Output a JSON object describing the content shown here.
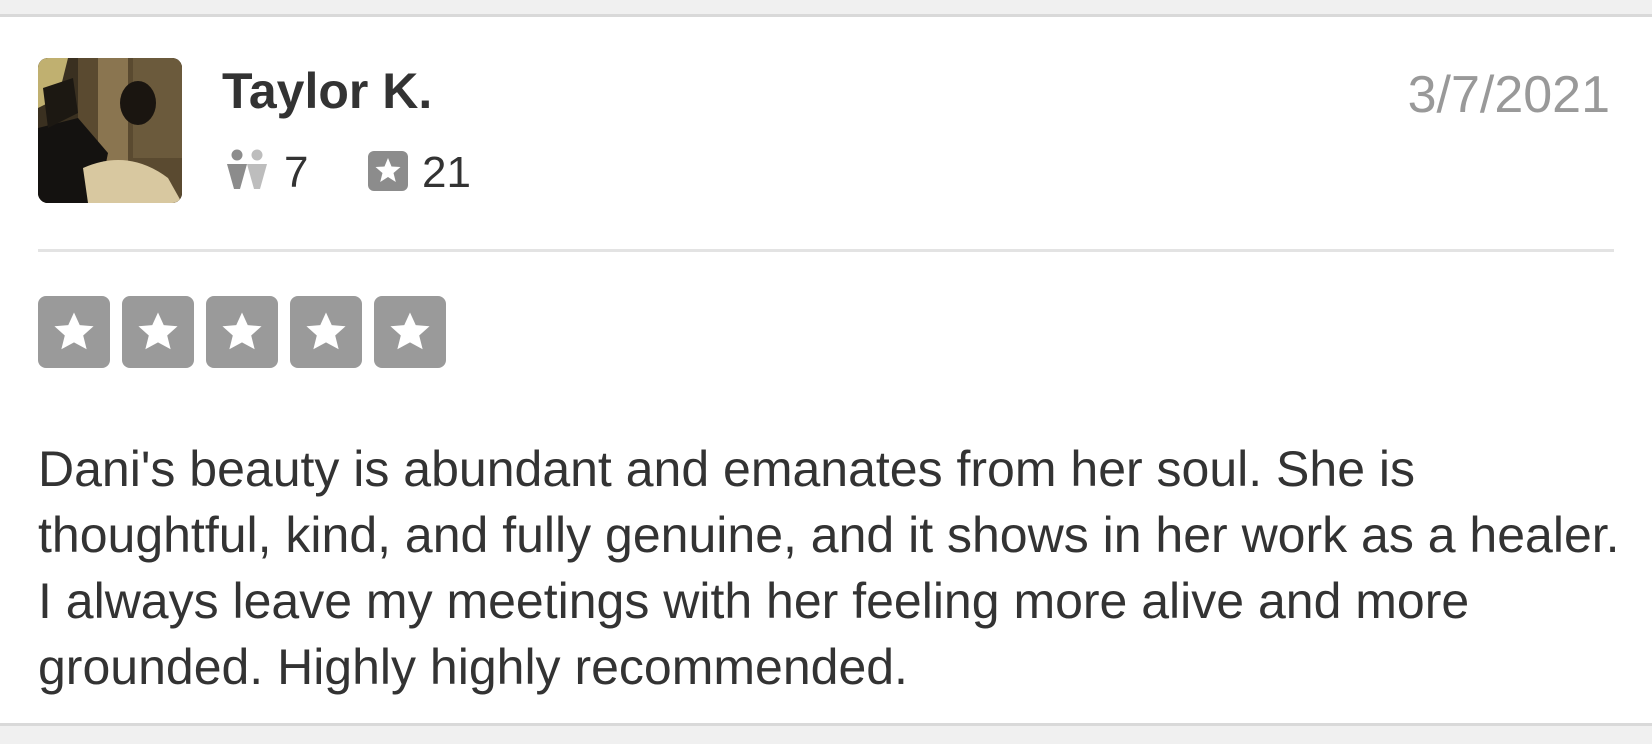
{
  "review": {
    "user_name": "Taylor K.",
    "date": "3/7/2021",
    "friend_count": "7",
    "review_count": "21",
    "rating": 5,
    "rating_max": 5,
    "text": "Dani's beauty is abundant and emanates from her soul. She is thoughtful, kind, and fully genuine, and it shows in her work as a healer. I always leave my meetings with her feeling more alive and more grounded. Highly highly recommended."
  },
  "icons": {
    "friends": "friends-icon",
    "reviews": "review-star-icon",
    "rating_star": "star-icon"
  },
  "colors": {
    "star_box": "#9a9a9a",
    "date": "#999999",
    "text": "#333333"
  }
}
